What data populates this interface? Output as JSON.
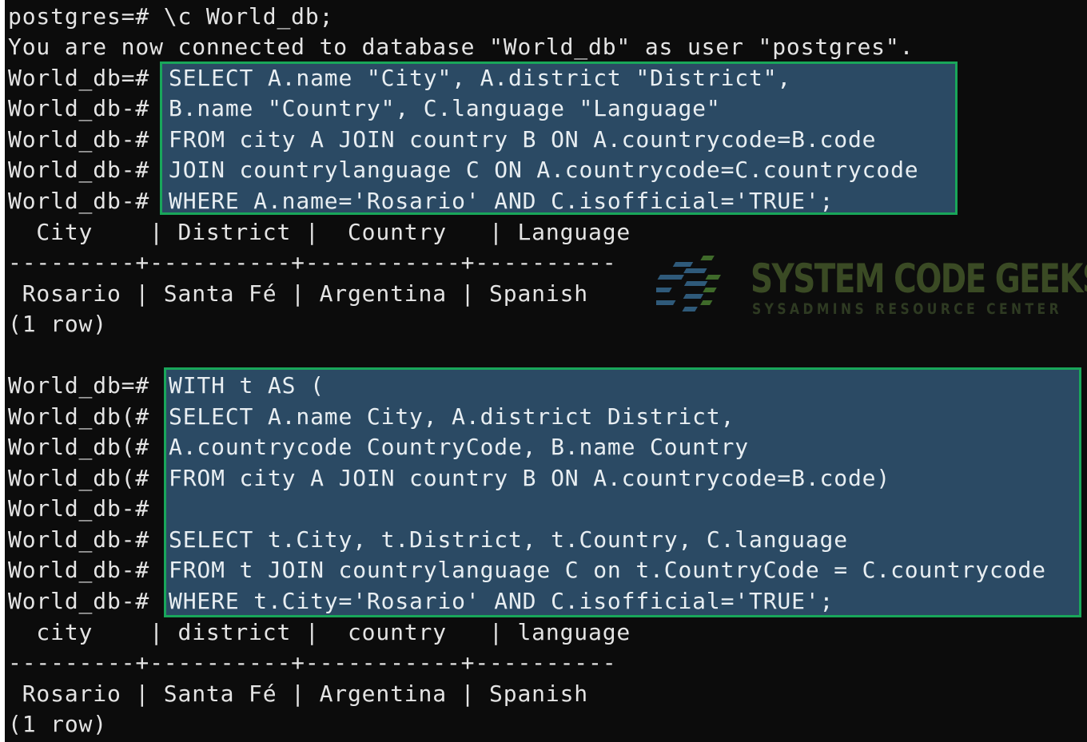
{
  "terminal": {
    "colors": {
      "background": "#0c0c0c",
      "text": "#e4e4e4",
      "highlight_fill": "#2b4a64",
      "highlight_border": "#19a65a"
    },
    "connect": {
      "prompt": "postgres=# ",
      "command": "\\c World_db;",
      "message": "You are now connected to database \"World_db\" as user \"postgres\"."
    },
    "query1": {
      "lines": [
        {
          "prompt": "World_db=# ",
          "sql": "SELECT A.name \"City\", A.district \"District\","
        },
        {
          "prompt": "World_db-# ",
          "sql": "B.name \"Country\", C.language \"Language\""
        },
        {
          "prompt": "World_db-# ",
          "sql": "FROM city A JOIN country B ON A.countrycode=B.code"
        },
        {
          "prompt": "World_db-# ",
          "sql": "JOIN countrylanguage C ON A.countrycode=C.countrycode"
        },
        {
          "prompt": "World_db-# ",
          "sql": "WHERE A.name='Rosario' AND C.isofficial='TRUE';"
        }
      ],
      "result": {
        "header": "  City    | District |  Country   | Language",
        "separator": "---------+----------+-----------+----------",
        "row": " Rosario | Santa Fé | Argentina | Spanish",
        "footer": "(1 row)"
      }
    },
    "query2": {
      "lines": [
        {
          "prompt": "World_db=# ",
          "sql": "WITH t AS ("
        },
        {
          "prompt": "World_db(# ",
          "sql": "SELECT A.name City, A.district District,"
        },
        {
          "prompt": "World_db(# ",
          "sql": "A.countrycode CountryCode, B.name Country"
        },
        {
          "prompt": "World_db(# ",
          "sql": "FROM city A JOIN country B ON A.countrycode=B.code)"
        },
        {
          "prompt": "World_db-# ",
          "sql": ""
        },
        {
          "prompt": "World_db-# ",
          "sql": "SELECT t.City, t.District, t.Country, C.language"
        },
        {
          "prompt": "World_db-# ",
          "sql": "FROM t JOIN countrylanguage C on t.CountryCode = C.countrycode"
        },
        {
          "prompt": "World_db-# ",
          "sql": "WHERE t.City='Rosario' AND C.isofficial='TRUE';"
        }
      ],
      "result": {
        "header": "  city    | district |  country   | language",
        "separator": "---------+----------+-----------+----------",
        "row": " Rosario | Santa Fé | Argentina | Spanish",
        "footer": "(1 row)"
      }
    }
  },
  "watermark": {
    "title": "SYSTEM CODE GEEKS",
    "subtitle": "SYSADMINS RESOURCE CENTER",
    "icon": "scg-logo-icon"
  }
}
